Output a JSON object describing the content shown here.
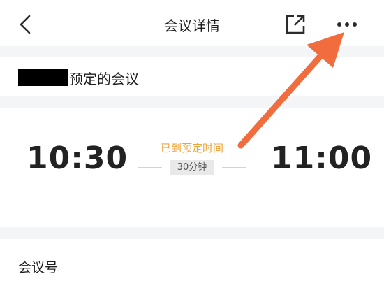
{
  "header": {
    "title": "会议详情",
    "back_icon": "chevron-left-icon",
    "share_icon": "external-share-icon",
    "more_icon": "more-horizontal-icon"
  },
  "meeting": {
    "organizer_suffix": "预定的会议",
    "start_time": "10:30",
    "end_time": "11:00",
    "status": "已到预定时间",
    "duration": "30分钟"
  },
  "details": {
    "meeting_number_label": "会议号"
  },
  "colors": {
    "status": "#f0a33a",
    "annotation_arrow": "#f26d3d",
    "background": "#f4f5f7"
  }
}
